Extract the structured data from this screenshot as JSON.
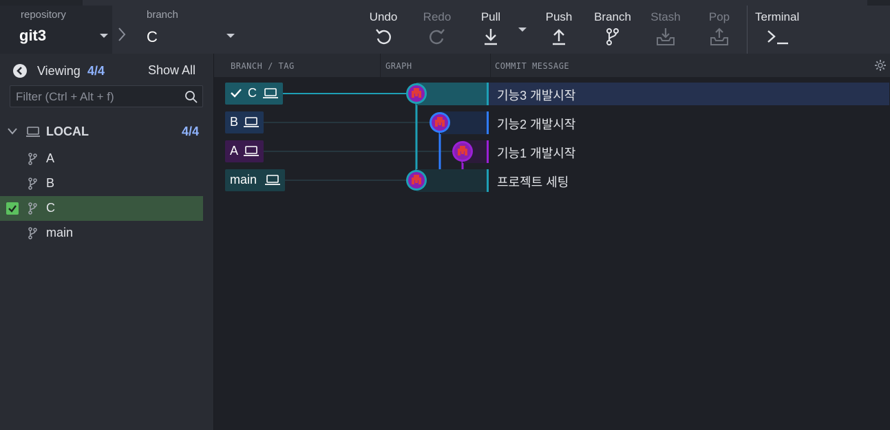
{
  "toolbar": {
    "repository_label": "repository",
    "repository_value": "git3",
    "branch_label": "branch",
    "branch_value": "C",
    "undo": "Undo",
    "redo": "Redo",
    "pull": "Pull",
    "push": "Push",
    "branch": "Branch",
    "stash": "Stash",
    "pop": "Pop",
    "terminal": "Terminal"
  },
  "sidebar": {
    "viewing_label": "Viewing",
    "viewing_count": "4/4",
    "show_all": "Show All",
    "filter_placeholder": "Filter (Ctrl + Alt + f)",
    "local_label": "LOCAL",
    "local_count": "4/4",
    "branches": [
      {
        "name": "A",
        "active": false
      },
      {
        "name": "B",
        "active": false
      },
      {
        "name": "C",
        "active": true
      },
      {
        "name": "main",
        "active": false
      }
    ]
  },
  "columns": {
    "branch_tag": "BRANCH / TAG",
    "graph": "GRAPH",
    "commit_message": "COMMIT MESSAGE"
  },
  "commits": [
    {
      "ref": "C",
      "checked_out": true,
      "message": "기능3 개발시작",
      "color": "#1e9fb5"
    },
    {
      "ref": "B",
      "checked_out": false,
      "message": "기능2 개발시작",
      "color": "#2f7cff"
    },
    {
      "ref": "A",
      "checked_out": false,
      "message": "기능1 개발시작",
      "color": "#9b20d6"
    },
    {
      "ref": "main",
      "checked_out": false,
      "message": "프로젝트 세팅",
      "color": "#1e9fb5"
    }
  ],
  "colors": {
    "accent": "#8fb3ff",
    "active_branch_bg": "#39573f",
    "check_green": "#5cc15f",
    "selected_row_bg": "#25314f"
  }
}
